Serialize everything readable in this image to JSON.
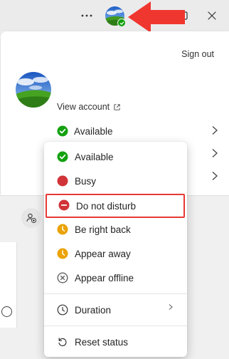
{
  "titlebar": {
    "more_icon": "more-horizontal-icon",
    "presence_color": "#13a10e",
    "arrow_color": "#f0372f"
  },
  "account": {
    "sign_out": "Sign out",
    "view_account": "View account",
    "current_status": "Available"
  },
  "status_menu": {
    "items": [
      {
        "label": "Available",
        "icon": "available-icon",
        "color": "#13a10e"
      },
      {
        "label": "Busy",
        "icon": "busy-icon",
        "color": "#d13438"
      },
      {
        "label": "Do not disturb",
        "icon": "do-not-disturb-icon",
        "color": "#d13438",
        "highlighted": true
      },
      {
        "label": "Be right back",
        "icon": "be-right-back-icon",
        "color": "#eaa300"
      },
      {
        "label": "Appear away",
        "icon": "appear-away-icon",
        "color": "#eaa300"
      },
      {
        "label": "Appear offline",
        "icon": "appear-offline-icon",
        "color": "#616161"
      }
    ],
    "duration": "Duration",
    "reset": "Reset status"
  }
}
